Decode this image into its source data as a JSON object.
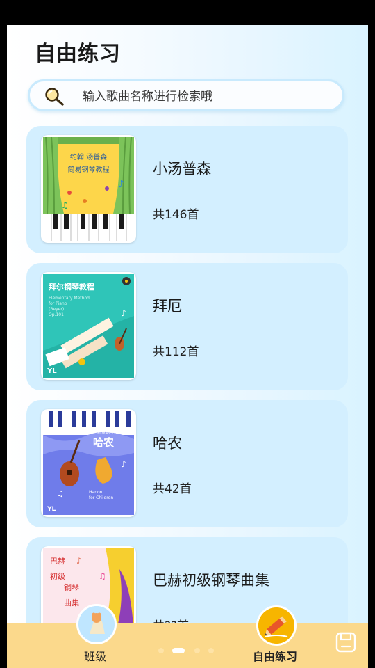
{
  "page": {
    "title": "自由练习"
  },
  "search": {
    "placeholder": "输入歌曲名称进行检索哦"
  },
  "books": [
    {
      "title": "小汤普森",
      "count": "共146首",
      "cover_text": [
        "约翰·汤普森",
        "简易钢琴教程"
      ]
    },
    {
      "title": "拜厄",
      "count": "共112首",
      "cover_text": [
        "拜尔钢琴教程",
        "Elementary Method",
        "for Piano",
        "(Beyer)",
        "Op.101"
      ]
    },
    {
      "title": "哈农",
      "count": "共42首",
      "cover_text": [
        "儿童钢琴教材",
        "哈农",
        "Hanon",
        "for Children"
      ]
    },
    {
      "title": "巴赫初级钢琴曲集",
      "count": "共??首",
      "cover_text": [
        "巴赫",
        "初级",
        "钢琴",
        "曲集"
      ]
    }
  ],
  "nav": {
    "class_label": "班级",
    "practice_label": "自由练习",
    "active": "自由练习"
  },
  "pager": {
    "pages": 4,
    "current": 2
  },
  "colors": {
    "card_bg": "#d3efff",
    "nav_bg": "#fbd98c",
    "search_border": "#c9eafd"
  }
}
